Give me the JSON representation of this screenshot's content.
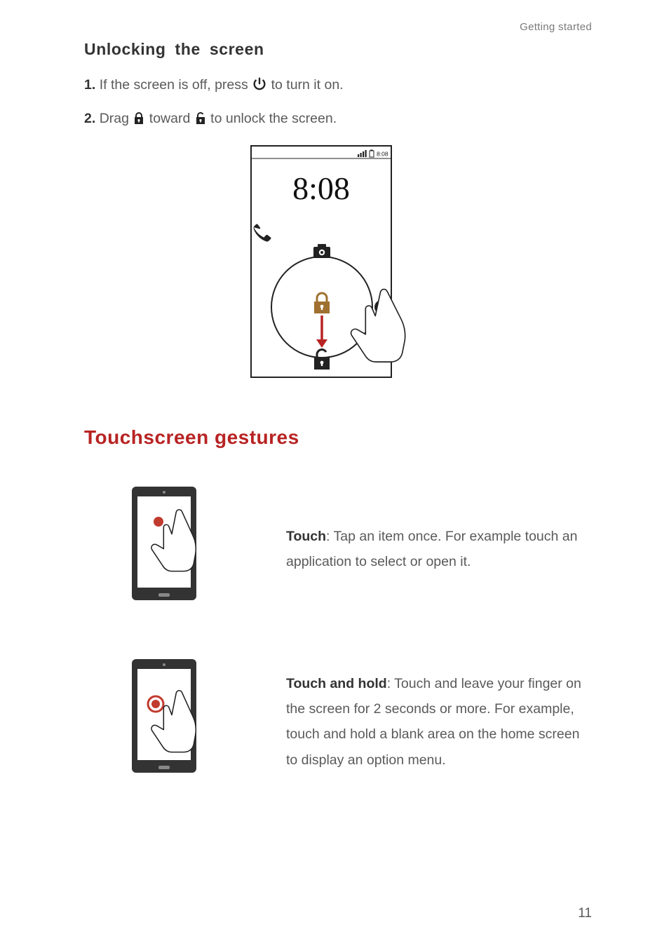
{
  "runningHead": "Getting started",
  "subheading": "Unlocking  the  screen",
  "steps": {
    "s1": {
      "num": "1.",
      "a": "If the screen is off, press ",
      "b": " to turn it on."
    },
    "s2": {
      "num": "2.",
      "a": "Drag ",
      "b": " toward ",
      "c": " to unlock the screen."
    }
  },
  "lockscreen": {
    "statusTime": "8:08",
    "bigTime": "8:08"
  },
  "sectionTitle": "Touchscreen gestures",
  "gestures": {
    "touch": {
      "label": "Touch",
      "text": ": Tap an item once. For example touch an application to select or open it."
    },
    "touchHold": {
      "label": "Touch and hold",
      "text": ": Touch and leave your finger on the screen for 2 seconds or more. For example, touch and hold a blank area on the home screen to display an option menu."
    }
  },
  "pageNumber": "11"
}
